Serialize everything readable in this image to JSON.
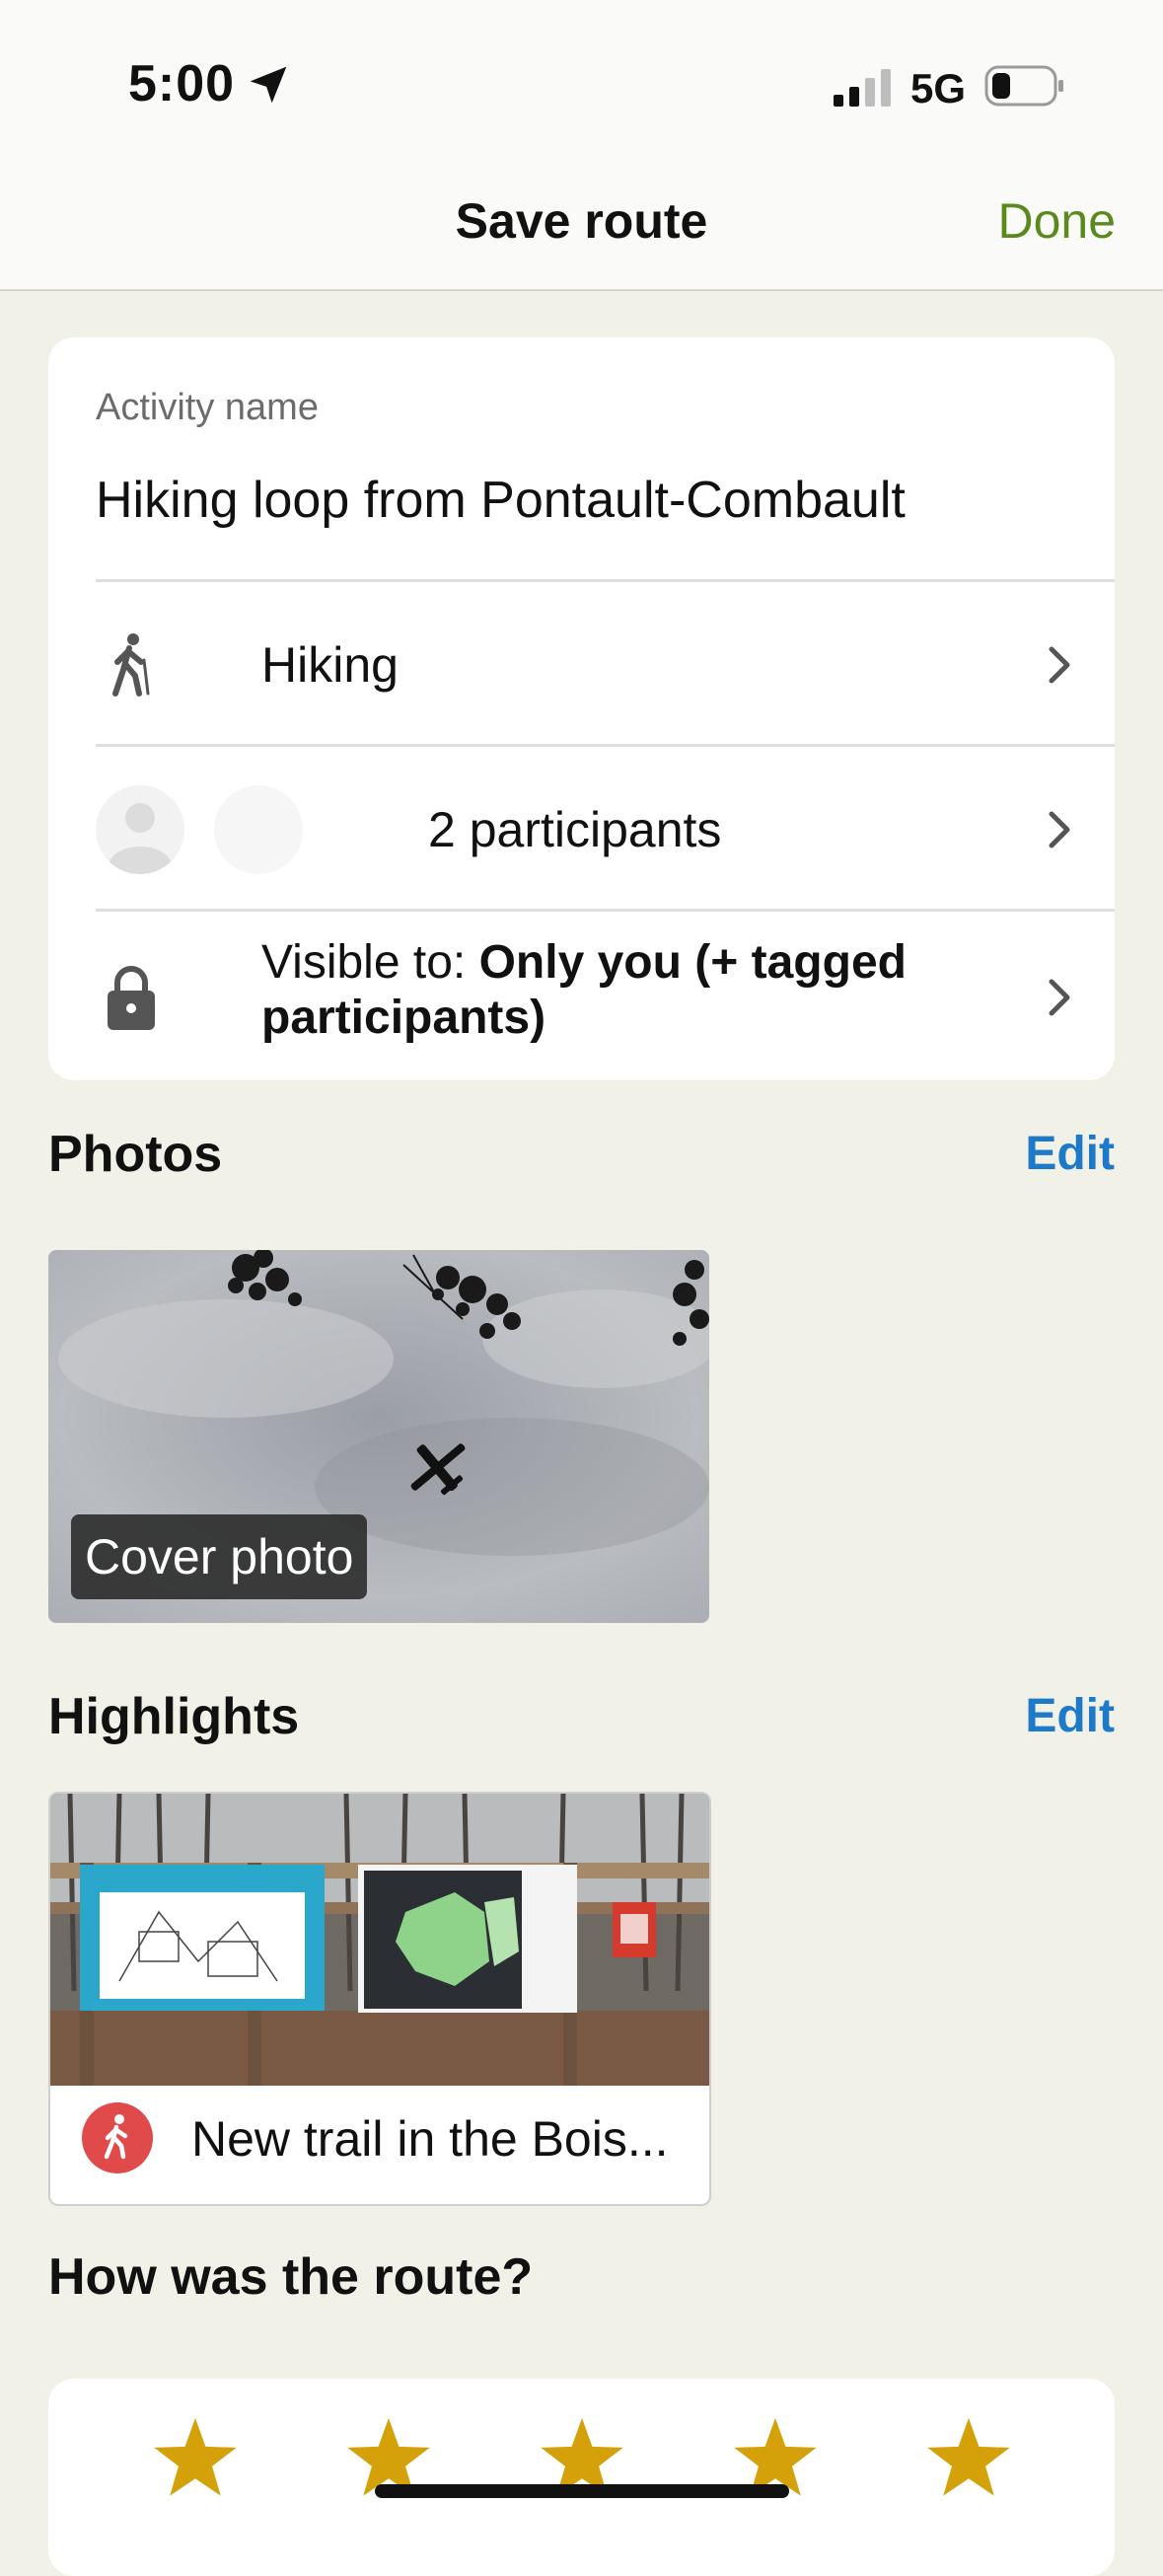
{
  "status_bar": {
    "time": "5:00",
    "network": "5G"
  },
  "nav": {
    "title": "Save route",
    "done_label": "Done"
  },
  "activity": {
    "name_label": "Activity name",
    "name_value": "Hiking loop from Pontault-Combault",
    "type_label": "Hiking",
    "participants_label": "2 participants",
    "visibility_prefix": "Visible to: ",
    "visibility_value": "Only you (+ tagged participants)"
  },
  "photos": {
    "title": "Photos",
    "edit_label": "Edit",
    "cover_label": "Cover photo"
  },
  "highlights": {
    "title": "Highlights",
    "edit_label": "Edit",
    "item_label": "New trail in the Bois..."
  },
  "rating": {
    "title": "How was the route?",
    "star_count": 5,
    "selected": 0
  },
  "colors": {
    "accent_green": "#5a8a1e",
    "link_blue": "#1c7ac8",
    "star_gold": "#d4a10a",
    "highlight_red": "#e04a4a"
  }
}
